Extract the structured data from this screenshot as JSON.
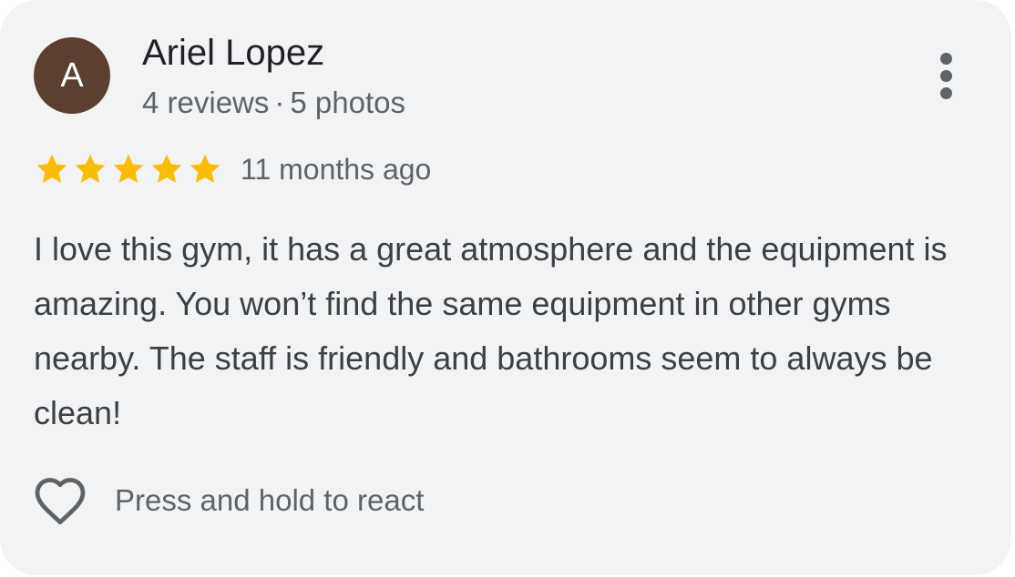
{
  "review": {
    "avatar_initial": "A",
    "reviewer_name": "Ariel Lopez",
    "reviews_count": "4 reviews",
    "separator": "·",
    "photos_count": "5 photos",
    "rating": 5,
    "rating_max": 5,
    "time_ago": "11 months ago",
    "text": "I love this gym, it has a great atmosphere and the equipment is amazing. You won’t find the same equipment in other gyms nearby. The staff is friendly and bathrooms seem to always be clean!",
    "react_label": "Press and hold to react"
  },
  "icons": {
    "more": "more-vert-icon",
    "star": "star-icon",
    "heart": "heart-outline-icon"
  },
  "colors": {
    "card_background": "#f2f3f5",
    "avatar_background": "#5b3f31",
    "star": "#fbbc04",
    "primary_text": "#202124",
    "secondary_text": "#5f6368"
  }
}
